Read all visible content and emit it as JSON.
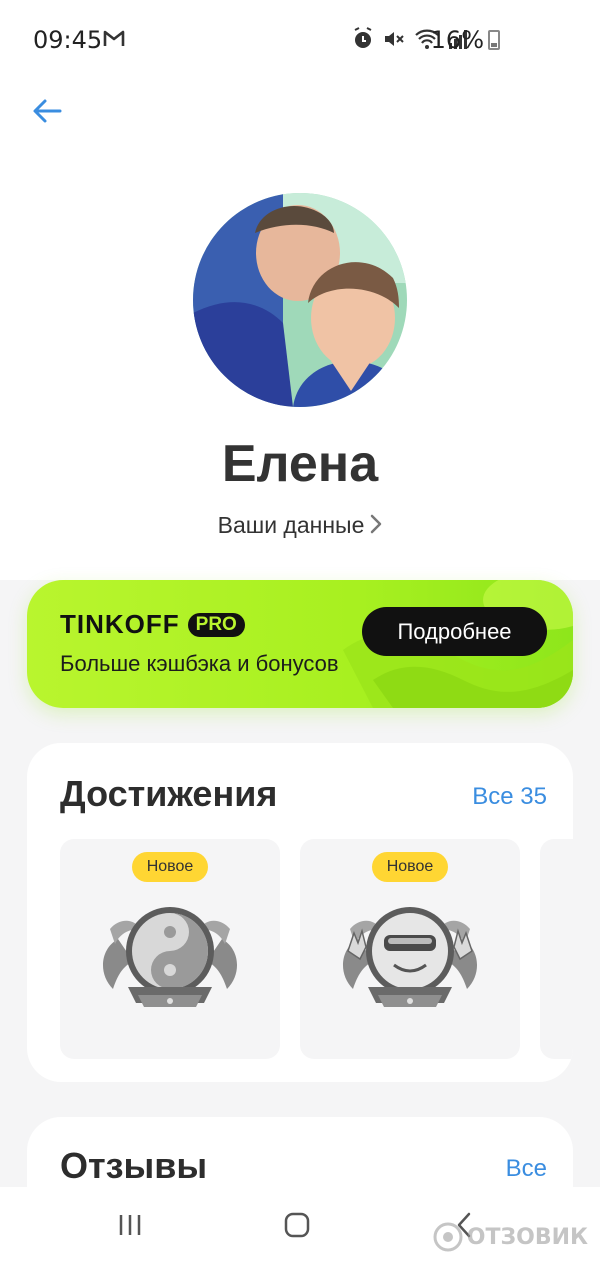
{
  "status_bar": {
    "time": "09:45",
    "battery": "16%",
    "icons": [
      "gmail-icon",
      "alarm-icon",
      "mute-icon",
      "wifi-icon",
      "signal-icon",
      "battery-icon"
    ]
  },
  "header": {
    "back_icon": "arrow-left-icon"
  },
  "profile": {
    "name": "Елена",
    "your_data_label": "Ваши данные"
  },
  "promo": {
    "brand": "TINKOFF",
    "brand_tag": "PRO",
    "subtitle": "Больше кэшбэка и бонусов",
    "button_label": "Подробнее",
    "colors": {
      "background": "#b9f52e",
      "button": "#111111"
    }
  },
  "achievements": {
    "title": "Достижения",
    "all_link": "Все 35",
    "items": [
      {
        "badge": "Новое",
        "icon": "yin-yang-cats-medal-icon"
      },
      {
        "badge": "Новое",
        "icon": "rock-sunglasses-medal-icon"
      }
    ]
  },
  "reviews": {
    "title": "Отзывы",
    "all_link": "Все"
  },
  "nav_bar": {
    "items": [
      "recent-apps-icon",
      "home-icon",
      "back-icon"
    ]
  },
  "watermark": "ОТЗОВИК",
  "colors": {
    "accent_link": "#3a8de0",
    "new_badge": "#ffd633"
  }
}
